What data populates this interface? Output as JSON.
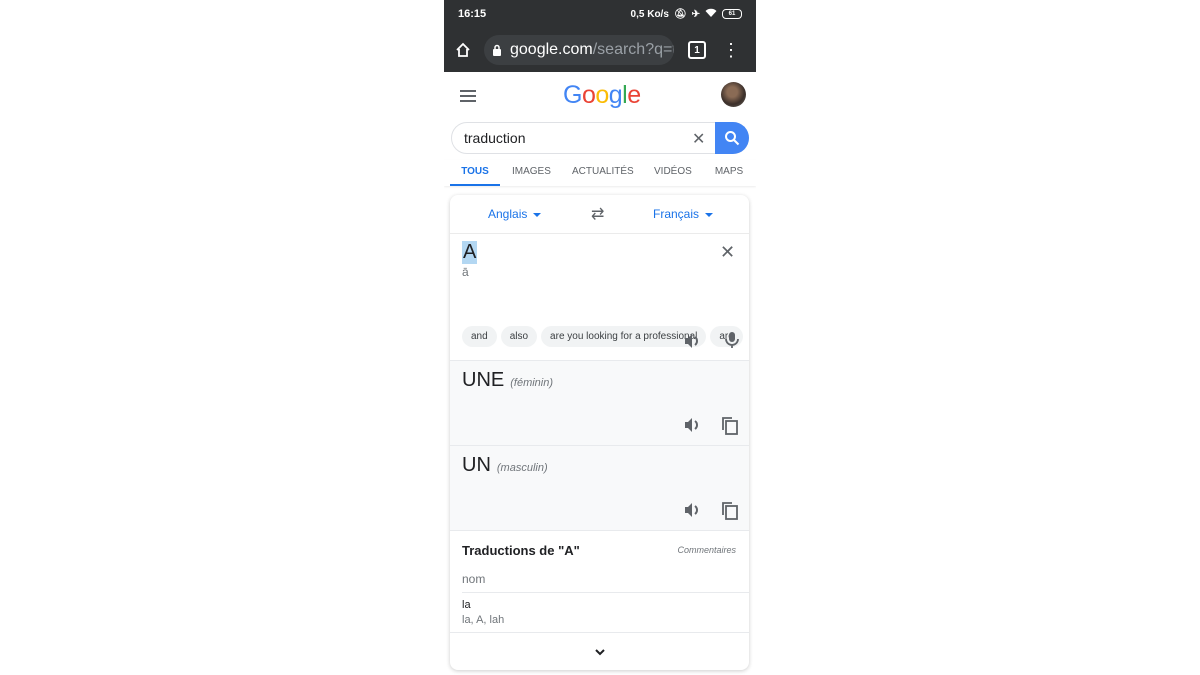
{
  "status_bar": {
    "time": "16:15",
    "network_speed": "0,5 Ko/s",
    "icons": [
      "bell-muted-icon",
      "airplane-icon",
      "wifi-icon",
      "battery-icon"
    ],
    "battery_level": "61"
  },
  "browser": {
    "url_host": "google.com",
    "url_path": "/search?q=t",
    "tab_count": "1",
    "icons": [
      "home-icon",
      "lock-icon",
      "tab-switcher-icon",
      "more-menu-icon"
    ]
  },
  "header": {
    "logo_letters": [
      {
        "char": "G",
        "color": "#4285f4"
      },
      {
        "char": "o",
        "color": "#ea4335"
      },
      {
        "char": "o",
        "color": "#fbbc05"
      },
      {
        "char": "g",
        "color": "#4285f4"
      },
      {
        "char": "l",
        "color": "#34a853"
      },
      {
        "char": "e",
        "color": "#ea4335"
      }
    ]
  },
  "search": {
    "query": "traduction",
    "accent_color": "#4285f4"
  },
  "tabs": [
    {
      "label": "TOUS",
      "active": true
    },
    {
      "label": "IMAGES",
      "active": false
    },
    {
      "label": "ACTUALITÉS",
      "active": false
    },
    {
      "label": "VIDÉOS",
      "active": false
    },
    {
      "label": "MAPS",
      "active": false
    }
  ],
  "translator": {
    "source_lang": "Anglais",
    "target_lang": "Français",
    "source_text": "A",
    "source_phonetic": "ā",
    "suggestions": [
      "and",
      "also",
      "are you looking for a professional",
      "are"
    ],
    "translations": [
      {
        "word": "UNE",
        "gender": "(féminin)"
      },
      {
        "word": "UN",
        "gender": "(masculin)"
      }
    ],
    "dictionary": {
      "title": "Traductions de \"A\"",
      "feedback": "Commentaires",
      "part_of_speech": "nom",
      "entries": [
        {
          "word": "la",
          "synonyms": "la, A, lah"
        }
      ]
    }
  }
}
